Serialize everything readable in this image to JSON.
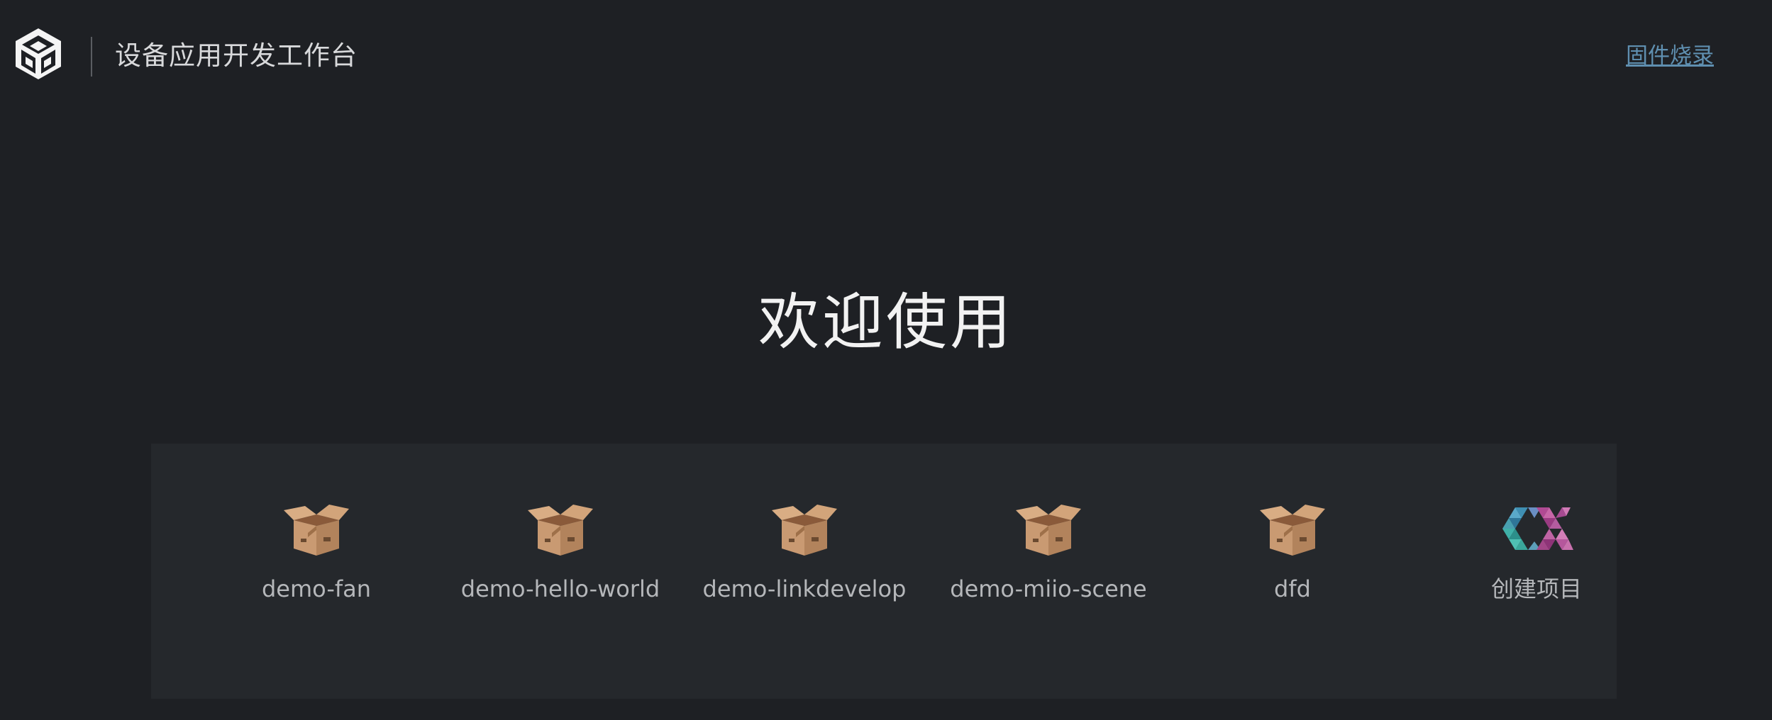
{
  "header": {
    "app_title": "设备应用开发工作台",
    "firmware_link": "固件烧录"
  },
  "welcome": {
    "heading": "欢迎使用"
  },
  "projects": [
    {
      "label": "demo-fan",
      "icon": "box-icon"
    },
    {
      "label": "demo-hello-world",
      "icon": "box-icon"
    },
    {
      "label": "demo-linkdevelop",
      "icon": "box-icon"
    },
    {
      "label": "demo-miio-scene",
      "icon": "box-icon"
    },
    {
      "label": "dfd",
      "icon": "box-icon"
    },
    {
      "label": "创建项目",
      "icon": "create-project-logo-icon"
    }
  ],
  "colors": {
    "background": "#1e2024",
    "panel": "#25282c",
    "link": "#5f8fb0",
    "text": "#b5b7ba"
  }
}
